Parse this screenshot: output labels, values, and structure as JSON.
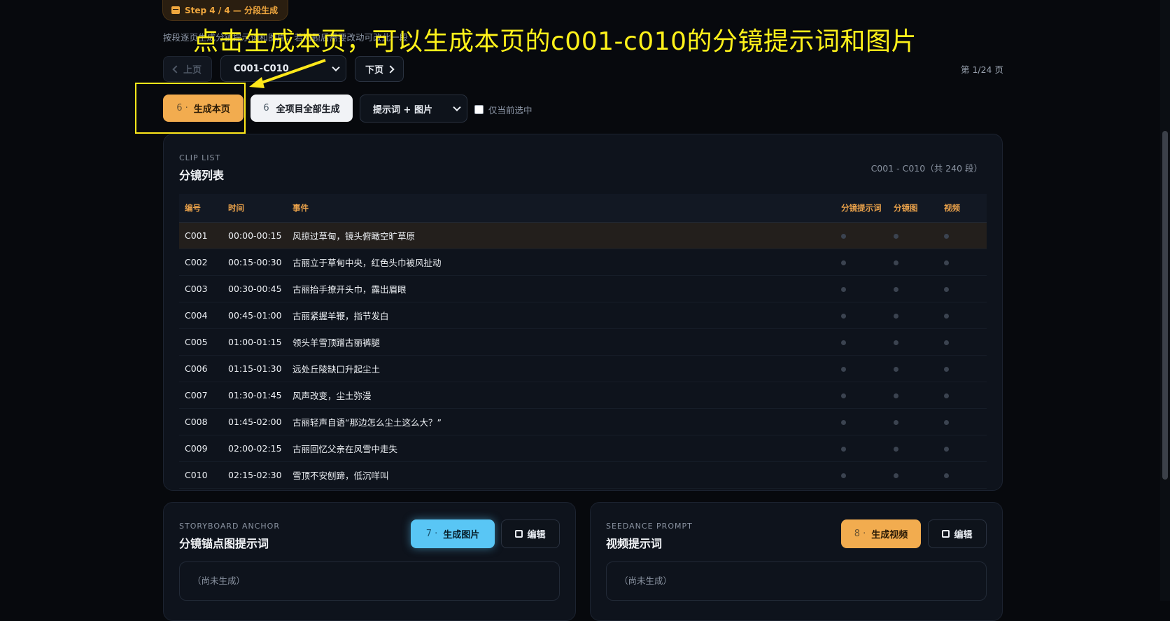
{
  "header": {
    "step_label": "Step 4 / 4 — 分段生成",
    "subtitle": "按段逐页生成分镜提示词和图片，若问题后需要改动可改此一段",
    "annotation": "点击生成本页，可以生成本页的c001-c010的分镜提示词和图片"
  },
  "pager": {
    "prev_label": "上页",
    "range_value": "C001-C010",
    "next_label": "下页",
    "page_count": "第 1/24 页"
  },
  "actions": {
    "gen_page_num": "6 ·",
    "gen_page_label": "生成本页",
    "gen_all_num": "6",
    "gen_all_label": "全项目全部生成",
    "mode_value": "提示词 + 图片",
    "only_current_label": "仅当前选中"
  },
  "clip_list": {
    "eyebrow": "CLIP LIST",
    "title": "分镜列表",
    "range_note": "C001 - C010（共 240 段）",
    "columns": [
      "编号",
      "时间",
      "事件",
      "分镜提示词",
      "分镜图",
      "视频"
    ],
    "rows": [
      {
        "id": "C001",
        "time": "00:00-00:15",
        "event": "风掠过草甸，镜头俯瞰空旷草原"
      },
      {
        "id": "C002",
        "time": "00:15-00:30",
        "event": "古丽立于草甸中央，红色头巾被风扯动"
      },
      {
        "id": "C003",
        "time": "00:30-00:45",
        "event": "古丽抬手撩开头巾，露出眉眼"
      },
      {
        "id": "C004",
        "time": "00:45-01:00",
        "event": "古丽紧握羊鞭，指节发白"
      },
      {
        "id": "C005",
        "time": "01:00-01:15",
        "event": "领头羊雪顶蹭古丽裤腿"
      },
      {
        "id": "C006",
        "time": "01:15-01:30",
        "event": "远处丘陵缺口升起尘土"
      },
      {
        "id": "C007",
        "time": "01:30-01:45",
        "event": "风声改变，尘土弥漫"
      },
      {
        "id": "C008",
        "time": "01:45-02:00",
        "event": "古丽轻声自语“那边怎么尘土这么大？”"
      },
      {
        "id": "C009",
        "time": "02:00-02:15",
        "event": "古丽回忆父亲在风雪中走失"
      },
      {
        "id": "C010",
        "time": "02:15-02:30",
        "event": "雪顶不安刨蹄，低沉咩叫"
      }
    ]
  },
  "anchor": {
    "eyebrow": "STORYBOARD ANCHOR",
    "title": "分镜锚点图提示词",
    "gen_num": "7 ·",
    "gen_label": "生成图片",
    "edit_label": "编辑",
    "empty": "（尚未生成）"
  },
  "seedance": {
    "eyebrow": "SEEDANCE PROMPT",
    "title": "视频提示词",
    "gen_num": "8 ·",
    "gen_label": "生成视频",
    "edit_label": "编辑",
    "empty": "（尚未生成）"
  },
  "colors": {
    "accent_orange": "#f2ac4f",
    "accent_blue": "#59c6f5",
    "annotation_yellow": "#fff21a",
    "background": "#07090d"
  }
}
